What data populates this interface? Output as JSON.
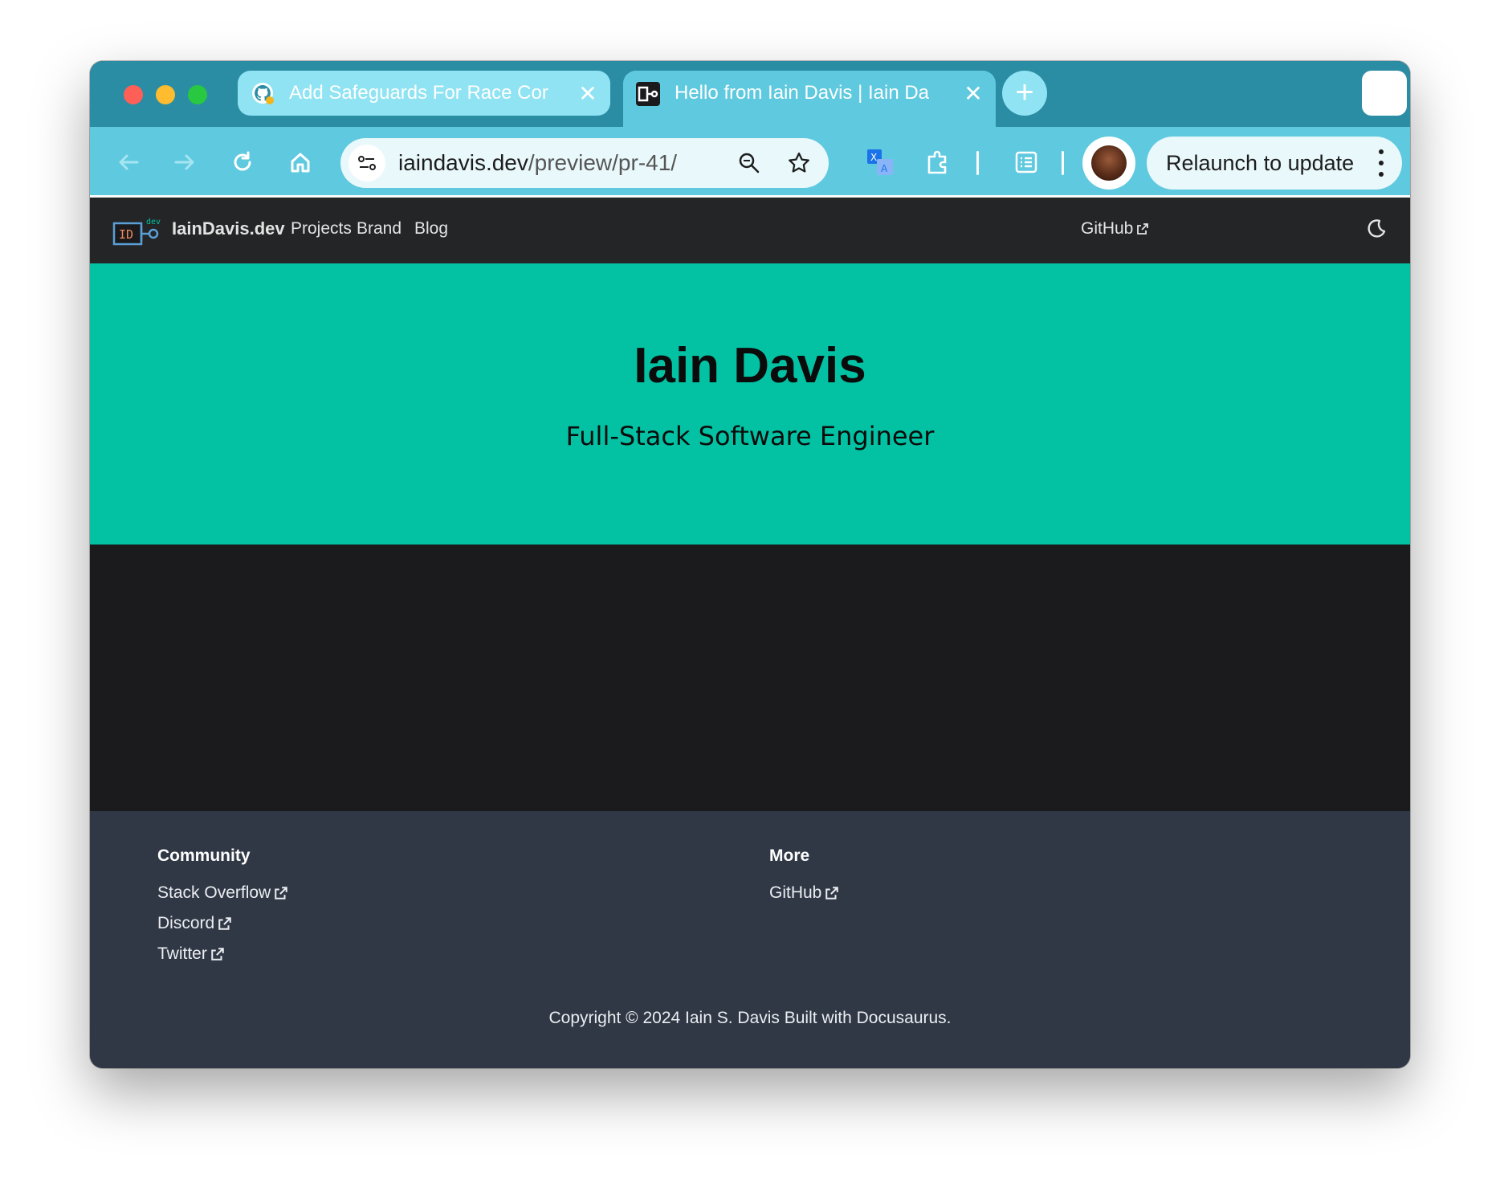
{
  "browser": {
    "tabs": [
      {
        "title": "Add Safeguards For Race Cor",
        "favicon": "github-icon"
      },
      {
        "title": "Hello from Iain Davis | Iain Da",
        "favicon": "iaindavis-icon"
      }
    ],
    "url_host": "iaindavis.dev",
    "url_path": "/preview/pr-41/",
    "relaunch_label": "Relaunch to update"
  },
  "site": {
    "logo_text": "ID",
    "logo_superscript": "dev",
    "brand": "IainDavis.dev",
    "nav": [
      "Projects",
      "Brand",
      "Blog"
    ],
    "github_label": "GitHub"
  },
  "hero": {
    "title": "Iain Davis",
    "subtitle": "Full-Stack Software Engineer"
  },
  "footer": {
    "columns": [
      {
        "title": "Community",
        "links": [
          "Stack Overflow",
          "Discord",
          "Twitter"
        ]
      },
      {
        "title": "More",
        "links": [
          "GitHub"
        ]
      }
    ],
    "copyright": "Copyright © 2024 Iain S. Davis Built with Docusaurus."
  },
  "colors": {
    "tabstrip": "#2b8da4",
    "toolbar": "#5ec9df",
    "hero": "#03c2a3",
    "navbar": "#242526",
    "footer": "#303846"
  }
}
